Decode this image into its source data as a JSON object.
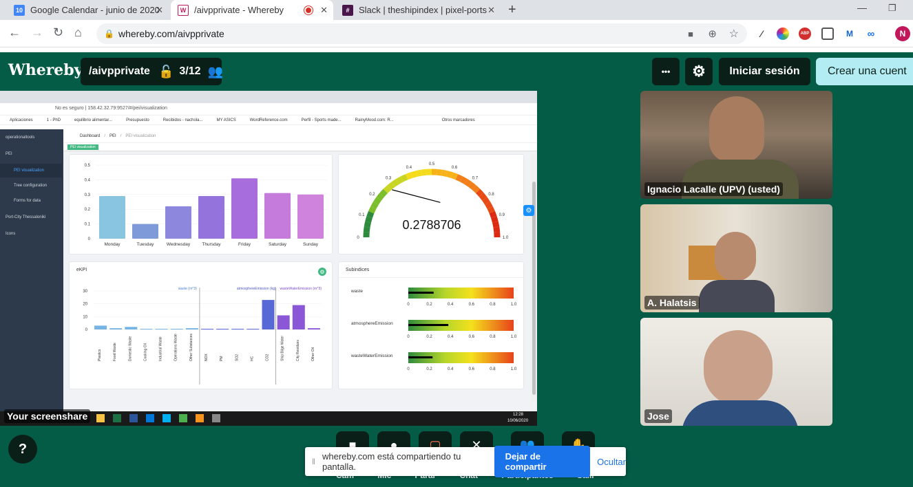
{
  "browser": {
    "tabs": [
      {
        "title": "Google Calendar - junio de 2020",
        "favicon_text": "10",
        "color": "#4285f4"
      },
      {
        "title": "/aivpprivate - Whereby",
        "favicon_text": "W",
        "color": "#c2185b"
      },
      {
        "title": "Slack | theshipindex | pixel-ports",
        "favicon_text": "#",
        "color": "#4a154b"
      }
    ],
    "url": "whereby.com/aivpprivate",
    "profile_initial": "N",
    "ext_abp": "ABP"
  },
  "whereby": {
    "logo": "Whereby",
    "room": "/aivpprivate",
    "participants_count": "3/12",
    "more_label": "•••",
    "login_label": "Iniciar sesión",
    "create_label": "Crear una cuent",
    "help_label": "?",
    "screenshare_label": "Your screenshare",
    "participants": [
      {
        "name": "Ignacio Lacalle (UPV) (usted)"
      },
      {
        "name": "A. Halatsis"
      },
      {
        "name": "Jose"
      }
    ],
    "toolbar_labels": [
      "Cam",
      "Mic",
      "Parar",
      "Chat",
      "Participantes",
      "Salir"
    ],
    "notice": {
      "text": "whereby.com está compartiendo tu pantalla.",
      "stop_label": "Dejar de compartir",
      "hide_label": "Ocultar"
    }
  },
  "shared": {
    "url": "No es seguro | 158.42.32.79:9527/#/pei/visualization",
    "bookmarks": [
      "Aplicaciones",
      "1 - PhD",
      "equilibrio alimentar...",
      "Presupuesto",
      "Recibidos - nachola...",
      "MY ASICS",
      "WordReference.com",
      "Perfil - Sports made...",
      "RainyMood.com: R...",
      "Otros marcadores"
    ],
    "breadcrumb": [
      "Dashboard",
      "PEI",
      "PEI visualization"
    ],
    "tag": "PEI visualization",
    "sidebar": [
      {
        "label": "operationaltools"
      },
      {
        "label": "PEI"
      },
      {
        "label": "PEI visualization"
      },
      {
        "label": "Tree configuration"
      },
      {
        "label": "Forms for data"
      },
      {
        "label": "Port-City Thessaloniki"
      },
      {
        "label": "Icons"
      }
    ],
    "gauge": {
      "value": 0.2788706,
      "value_text": "0.2788706",
      "ticks": [
        "0",
        "0.1",
        "0.2",
        "0.3",
        "0.4",
        "0.5",
        "0.6",
        "0.7",
        "0.8",
        "0.9",
        "1.0"
      ]
    },
    "ekpi_title": "eKPI",
    "subindices_title": "Subindices",
    "subindices": [
      {
        "label": "waste",
        "value": 0.24
      },
      {
        "label": "atmosphereEmission",
        "value": 0.38
      },
      {
        "label": "wasteWaterEmission",
        "value": 0.23
      }
    ],
    "bar_ticks": [
      "0",
      "0.2",
      "0.4",
      "0.6",
      "0.8",
      "1.0"
    ],
    "taskbar_time": "12:28",
    "taskbar_date": "10/06/2020"
  },
  "chart_data": [
    {
      "type": "bar",
      "categories": [
        "Monday",
        "Tuesday",
        "Wednesday",
        "Thursday",
        "Friday",
        "Saturday",
        "Sunday"
      ],
      "values": [
        0.29,
        0.1,
        0.22,
        0.29,
        0.41,
        0.31,
        0.3
      ],
      "ylim": [
        0,
        0.5
      ],
      "yticks": [
        "0",
        "0.1",
        "0.2",
        "0.3",
        "0.4",
        "0.5"
      ],
      "colors": [
        "#89c4e1",
        "#7f9ad8",
        "#8d87dd",
        "#9473dd",
        "#a86ddc",
        "#c47bdc",
        "#d083dd"
      ]
    },
    {
      "type": "bar",
      "categories": [
        "Plastics",
        "Food Waste",
        "Domestic Waste",
        "Cooking Oil",
        "Industrial Waste",
        "Operations Waste",
        "Other Substances",
        "NOX",
        "PM",
        "SO2",
        "HC",
        "CO2",
        "Ship Bilge Water",
        "City Residues",
        "Other Oil"
      ],
      "values": [
        3,
        1,
        2,
        0,
        0,
        0,
        1,
        0,
        0,
        0,
        0,
        23,
        11,
        19,
        1
      ],
      "ylim": [
        0,
        30
      ],
      "yticks": [
        "0",
        "10",
        "20",
        "30"
      ],
      "legend": [
        "waste (m^3)",
        "atmosphereEmission (kg)",
        "wasteWaterEmission (m^3)"
      ]
    }
  ]
}
